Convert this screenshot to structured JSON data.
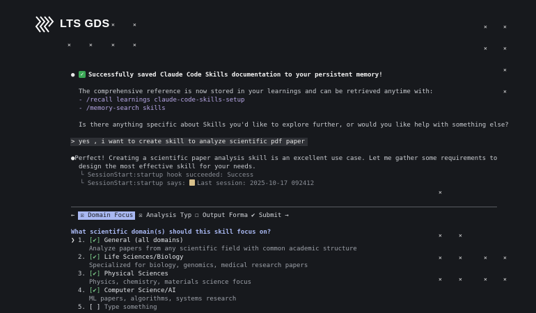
{
  "brand": {
    "name": "LTS GDS"
  },
  "session": {
    "saved_message": "Successfully saved Claude Code Skills documentation to your persistent memory!",
    "reference_line": "The comprehensive reference is now stored in your learnings and can be retrieved anytime with:",
    "commands": [
      "- /recall learnings claude-code-skills-setup",
      "- /memory-search skills"
    ],
    "followup": "Is there anything specific about Skills you'd like to explore further, or would you like help with something else?",
    "user_prompt": "> yes , i want to create skill to analyze scientific pdf paper",
    "reply_line1": "Perfect! Creating a scientific paper analysis skill is an excellent use case. Let me gather some requirements to",
    "reply_line2": "design the most effective skill for your needs.",
    "hook_line1": "└ SessionStart:startup hook succeeded: Success",
    "hook_line2_prefix": "└ SessionStart:startup says: ",
    "hook_line2_suffix": "Last session: 2025-10-17 092412"
  },
  "wizard": {
    "back_arrow": "←",
    "next_arrow": "→",
    "tabs": [
      {
        "label": "☒ Domain Focus"
      },
      {
        "label": "☒ Analysis Typ"
      },
      {
        "label": "☐ Output Forma"
      },
      {
        "label": "✔ Submit"
      }
    ],
    "question": "What scientific domain(s) should this skill focus on?",
    "options": [
      {
        "num": "1.",
        "box": "[✔]",
        "label": "General (all domains)",
        "desc": "Analyze papers from any scientific field with common academic structure"
      },
      {
        "num": "2.",
        "box": "[✔]",
        "label": "Life Sciences/Biology",
        "desc": "Specialized for biology, genomics, medical research papers"
      },
      {
        "num": "3.",
        "box": "[✔]",
        "label": "Physical Sciences",
        "desc": "Physics, chemistry, materials science focus"
      },
      {
        "num": "4.",
        "box": "[✔]",
        "label": "Computer Science/AI",
        "desc": "ML papers, algorithms, systems research"
      },
      {
        "num": "5.",
        "box": "[ ]",
        "label": "Type something",
        "desc": ""
      }
    ],
    "cursor": "❯"
  },
  "colors": {
    "background": "#17191d",
    "accent": "#a9b8f2",
    "check": "#7fcf8c",
    "link": "#b7a7e6"
  }
}
